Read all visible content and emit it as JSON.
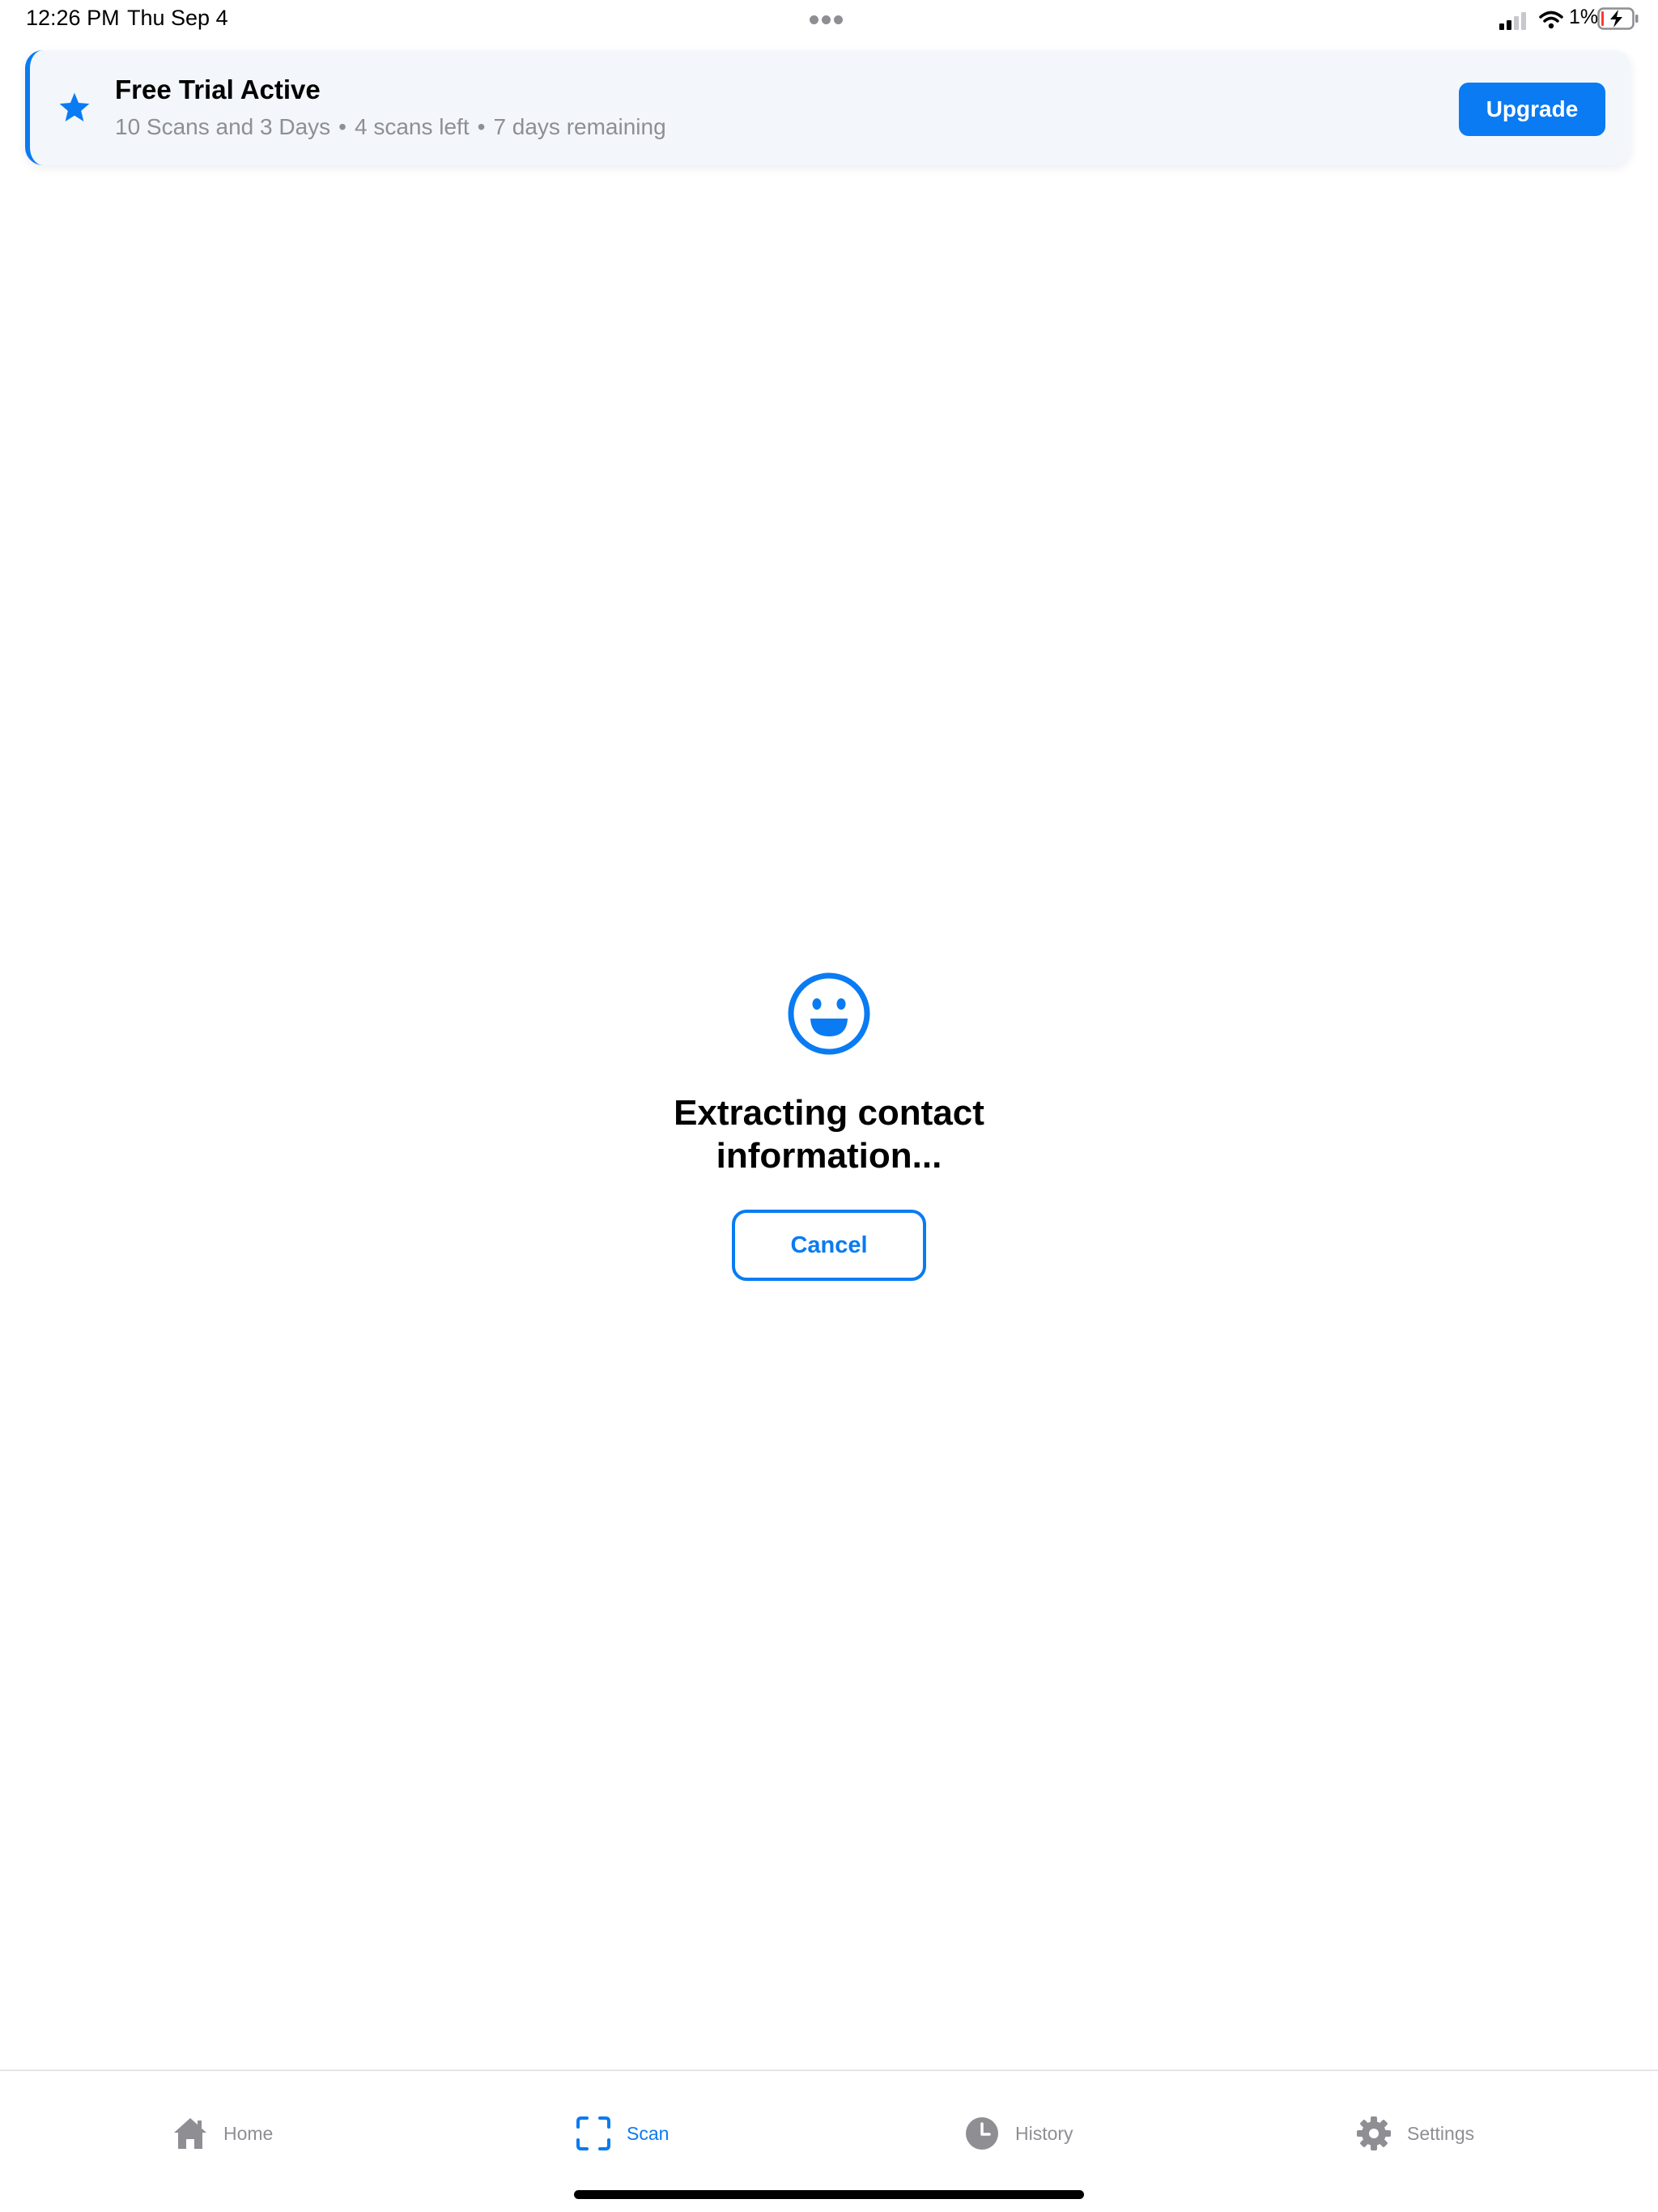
{
  "status_bar": {
    "time": "12:26 PM",
    "date": "Thu Sep 4",
    "battery_percent": "1%"
  },
  "trial_banner": {
    "title": "Free Trial Active",
    "plan": "10 Scans and 3 Days",
    "separator": "•",
    "scans_left": "4 scans left",
    "days_remaining": "7 days remaining",
    "upgrade_label": "Upgrade",
    "accent_color": "#0a7bf2"
  },
  "main": {
    "icon": "smiley-face-icon",
    "message": "Extracting contact information...",
    "cancel_label": "Cancel"
  },
  "tab_bar": {
    "items": [
      {
        "label": "Home",
        "icon": "house-icon",
        "active": false
      },
      {
        "label": "Scan",
        "icon": "viewfinder-icon",
        "active": true
      },
      {
        "label": "History",
        "icon": "clock-icon",
        "active": false
      },
      {
        "label": "Settings",
        "icon": "gear-icon",
        "active": false
      }
    ]
  }
}
